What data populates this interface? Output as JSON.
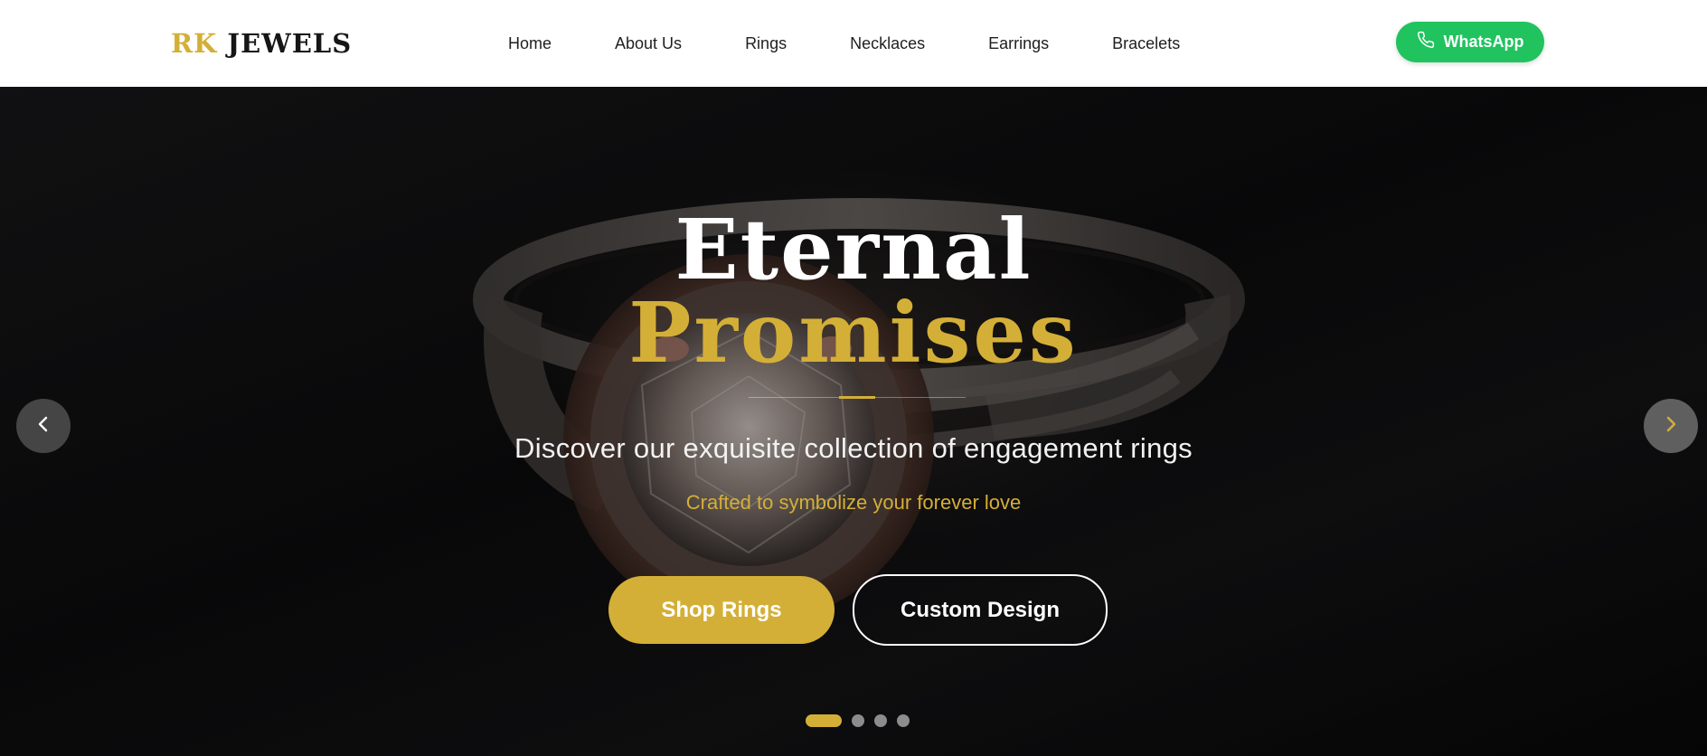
{
  "brand": {
    "part1": "RK",
    "part2": "JEWELS"
  },
  "nav": {
    "items": [
      {
        "label": "Home"
      },
      {
        "label": "About Us"
      },
      {
        "label": "Rings"
      },
      {
        "label": "Necklaces"
      },
      {
        "label": "Earrings"
      },
      {
        "label": "Bracelets"
      }
    ]
  },
  "whatsapp": {
    "label": "WhatsApp",
    "icon": "phone-icon",
    "color": "#20c35e"
  },
  "hero": {
    "title_line1": "Eternal",
    "title_line2": "Promises",
    "subtitle": "Discover our exquisite collection of engagement rings",
    "tagline": "Crafted to symbolize your forever love",
    "primary_button": "Shop Rings",
    "secondary_button": "Custom Design",
    "prev_icon": "chevron-left-icon",
    "next_icon": "chevron-right-icon",
    "slide_count": 4,
    "active_slide": 1
  },
  "colors": {
    "accent_gold": "#d4af37",
    "header_bg": "#ffffff",
    "hero_bg": "#0b0b0c"
  }
}
